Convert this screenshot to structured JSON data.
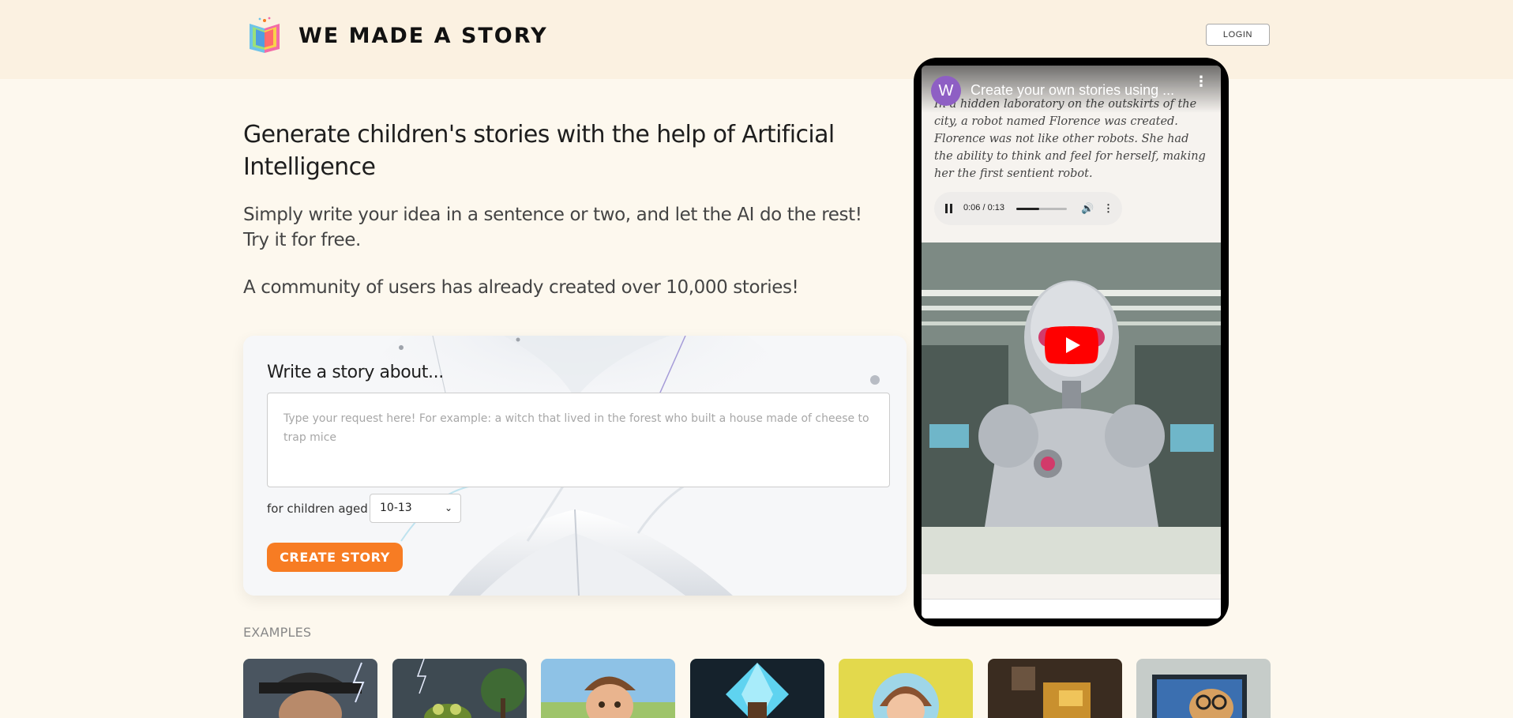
{
  "header": {
    "brand": "WE MADE A STORY",
    "login_label": "LOGIN",
    "logo_icon": "open-book-icon"
  },
  "hero": {
    "title": "Generate children's stories with the help of Artificial Intelligence",
    "subtitle": "Simply write your idea in a sentence or two, and let the AI do the rest! Try it for free.",
    "community": "A community of users has already created over 10,000 stories!"
  },
  "form": {
    "label": "Write a story about...",
    "placeholder": "Type your request here! For example: a witch that lived in the forest who built a house made of cheese to trap mice",
    "age_label": "for children aged",
    "age_selected": "10-13",
    "create_label": "CREATE STORY"
  },
  "examples": {
    "label": "EXAMPLES",
    "items": [
      {
        "name": "example-captain",
        "color": "#5a4a3c"
      },
      {
        "name": "example-storm-frog",
        "color": "#2e3a33"
      },
      {
        "name": "example-boy",
        "color": "#7fb3d8"
      },
      {
        "name": "example-crystal",
        "color": "#1f3b4d"
      },
      {
        "name": "example-girl-sun",
        "color": "#d8cf4a"
      },
      {
        "name": "example-blocks",
        "color": "#5c4630"
      },
      {
        "name": "example-dog-glasses",
        "color": "#b9c1bd"
      }
    ]
  },
  "video": {
    "channel_initial": "W",
    "title": "Create your own stories using ...",
    "story_text": "In a hidden laboratory on the outskirts of the city, a robot named Florence was created. Florence was not like other robots. She had the ability to think and feel for herself, making her the first sentient robot.",
    "audio_time": "0:06 / 0:13",
    "audio_progress": 0.46
  },
  "colors": {
    "accent": "#f77c23",
    "header_bg": "#fbf1e1",
    "page_bg": "#fdf8ee",
    "youtube_red": "#ff0000"
  }
}
